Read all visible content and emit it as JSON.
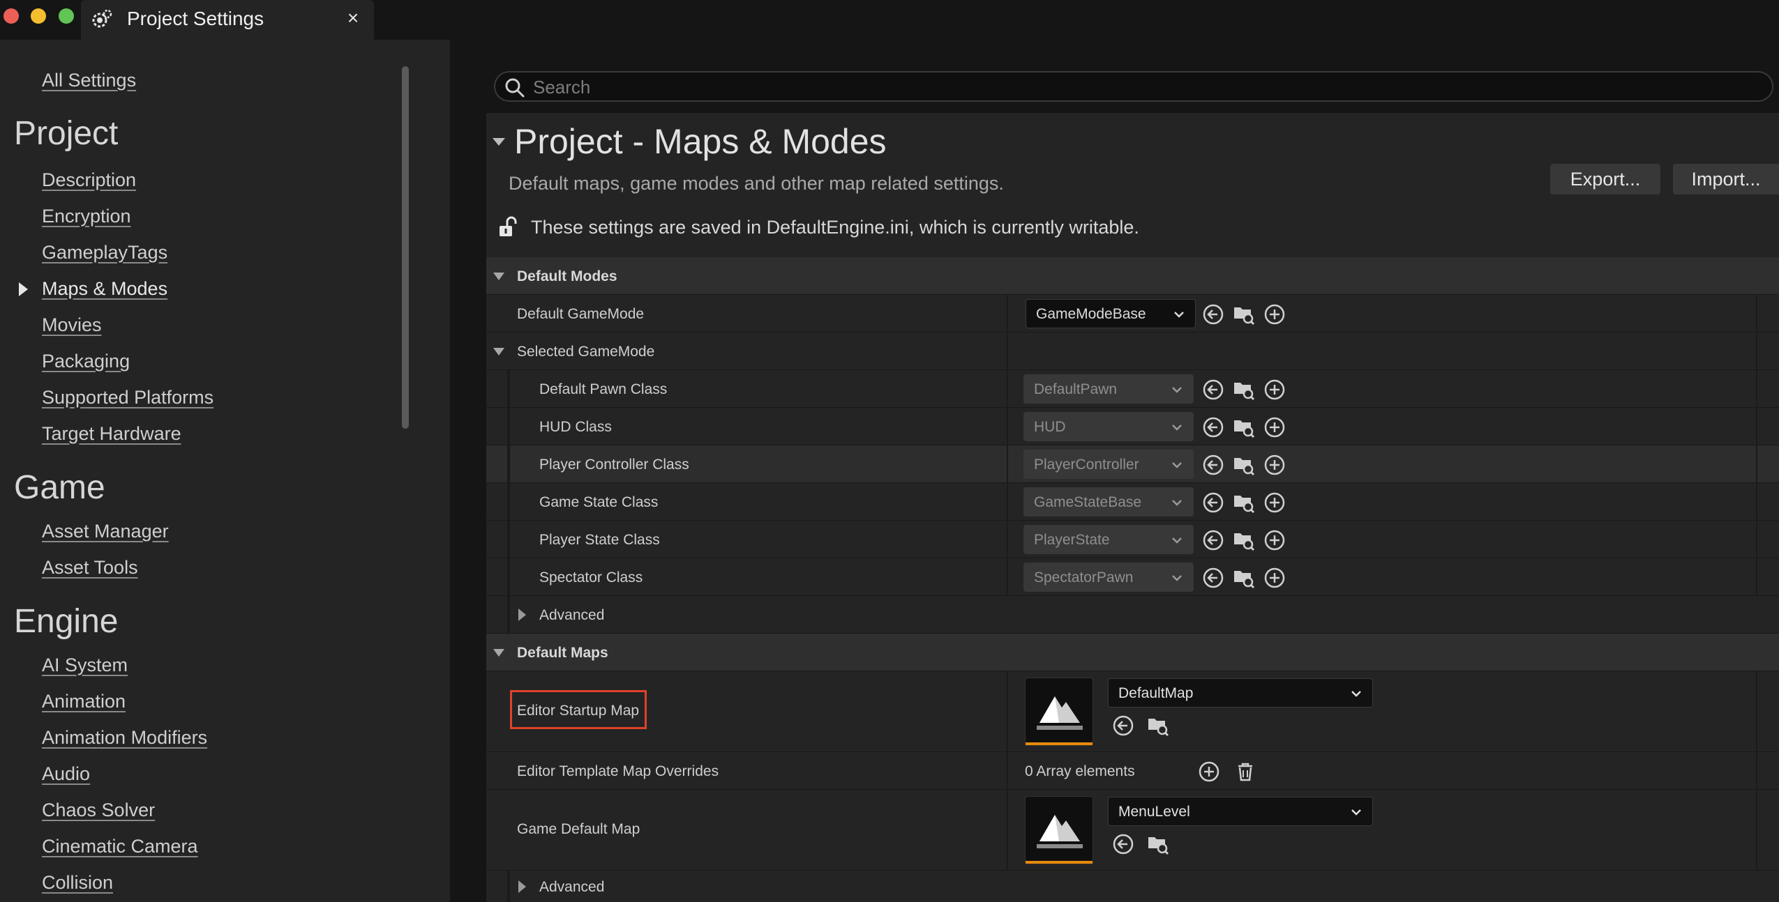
{
  "window": {
    "tab_title": "Project Settings",
    "close_label": "×"
  },
  "sidebar": {
    "all_settings": "All Settings",
    "sections": [
      {
        "title": "Project",
        "items": [
          "Description",
          "Encryption",
          "GameplayTags",
          "Maps & Modes",
          "Movies",
          "Packaging",
          "Supported Platforms",
          "Target Hardware"
        ]
      },
      {
        "title": "Game",
        "items": [
          "Asset Manager",
          "Asset Tools"
        ]
      },
      {
        "title": "Engine",
        "items": [
          "AI System",
          "Animation",
          "Animation Modifiers",
          "Audio",
          "Chaos Solver",
          "Cinematic Camera",
          "Collision"
        ]
      }
    ],
    "active_item": "Maps & Modes"
  },
  "search": {
    "placeholder": "Search",
    "value": ""
  },
  "header": {
    "title": "Project - Maps & Modes",
    "description": "Default maps, game modes and other map related settings.",
    "export_label": "Export...",
    "import_label": "Import...",
    "config_notice": "These settings are saved in DefaultEngine.ini, which is currently writable."
  },
  "default_modes": {
    "title": "Default Modes",
    "default_gamemode": {
      "label": "Default GameMode",
      "value": "GameModeBase"
    },
    "selected_gamemode": {
      "label": "Selected GameMode",
      "rows": [
        {
          "label": "Default Pawn Class",
          "value": "DefaultPawn"
        },
        {
          "label": "HUD Class",
          "value": "HUD"
        },
        {
          "label": "Player Controller Class",
          "value": "PlayerController"
        },
        {
          "label": "Game State Class",
          "value": "GameStateBase"
        },
        {
          "label": "Player State Class",
          "value": "PlayerState"
        },
        {
          "label": "Spectator Class",
          "value": "SpectatorPawn"
        }
      ],
      "advanced_label": "Advanced"
    }
  },
  "default_maps": {
    "title": "Default Maps",
    "editor_startup_map": {
      "label": "Editor Startup Map",
      "value": "DefaultMap"
    },
    "editor_template_overrides": {
      "label": "Editor Template Map Overrides",
      "value": "0 Array elements"
    },
    "game_default_map": {
      "label": "Game Default Map",
      "value": "MenuLevel"
    },
    "advanced_label": "Advanced"
  },
  "colors": {
    "accent_orange": "#e8890c",
    "highlight_red": "#e0412c"
  }
}
